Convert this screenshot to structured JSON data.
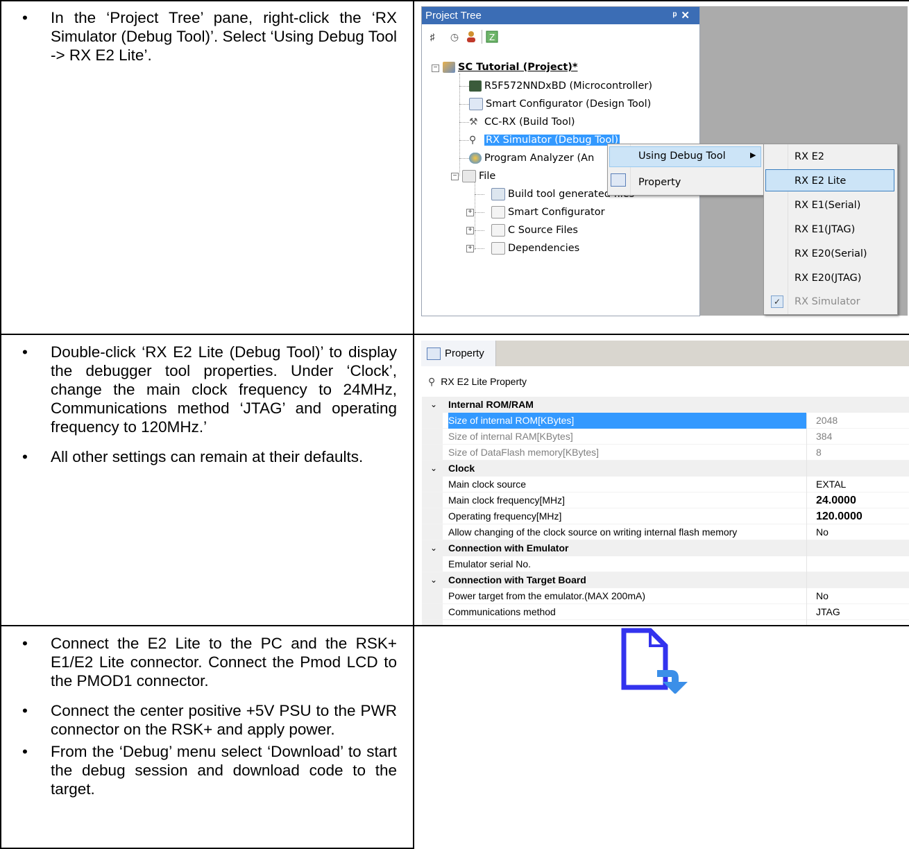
{
  "rows": [
    {
      "bullets": [
        "In the ‘Project Tree’ pane, right-click the ‘RX Simulator (Debug Tool)’.    Select ‘Using Debug Tool -> RX E2 Lite’."
      ]
    },
    {
      "bullets": [
        "Double-click ‘RX E2 Lite (Debug Tool)’ to display the debugger tool properties. Under ‘Clock’, change the main clock frequency to 24MHz, Communications method ‘JTAG’ and operating frequency to 120MHz.’",
        "All other settings can remain at their defaults."
      ]
    },
    {
      "bullets": [
        "Connect the E2 Lite to the PC and the RSK+ E1/E2 Lite connector.  Connect the Pmod LCD to the PMOD1 connector.",
        "Connect the center positive +5V PSU to the PWR connector on the RSK+ and apply power.",
        "From the ‘Debug’ menu select ‘Download’ to start the debug session and download code to the target."
      ]
    }
  ],
  "bullet_char": "•",
  "project_tree": {
    "title": "Project Tree",
    "pin": "ᵖ",
    "close": "✕",
    "project": "SC Tutorial (Project)*",
    "items": [
      "R5F572NNDxBD (Microcontroller)",
      "Smart Configurator (Design Tool)",
      "CC-RX (Build Tool)",
      "RX Simulator (Debug Tool)",
      "Program Analyzer (An",
      "File",
      "Build tool generated files",
      "Smart Configurator",
      "C Source Files",
      "Dependencies"
    ]
  },
  "context_menu": {
    "items": [
      "Using Debug Tool",
      "Property"
    ],
    "submenu": [
      "RX E2",
      "RX E2 Lite",
      "RX E1(Serial)",
      "RX E1(JTAG)",
      "RX E20(Serial)",
      "RX E20(JTAG)",
      "RX Simulator"
    ],
    "selected": "RX E2 Lite",
    "checked": "RX Simulator"
  },
  "property": {
    "tab": "Property",
    "header": "RX E2 Lite Property",
    "rows": [
      {
        "type": "cat",
        "name": "Internal ROM/RAM"
      },
      {
        "type": "sel",
        "name": "Size of internal ROM[KBytes]",
        "value": "2048"
      },
      {
        "type": "dim",
        "name": "Size of internal RAM[KBytes]",
        "value": "384"
      },
      {
        "type": "dim",
        "name": "Size of DataFlash memory[KBytes]",
        "value": "8"
      },
      {
        "type": "cat",
        "name": "Clock"
      },
      {
        "type": "row",
        "name": "Main clock source",
        "value": "EXTAL"
      },
      {
        "type": "bold",
        "name": "Main clock frequency[MHz]",
        "value": "24.0000"
      },
      {
        "type": "bold",
        "name": "Operating frequency[MHz]",
        "value": "120.0000"
      },
      {
        "type": "row",
        "name": "Allow changing of the clock source on writing internal flash memory",
        "value": "No"
      },
      {
        "type": "cat",
        "name": "Connection with Emulator"
      },
      {
        "type": "row",
        "name": "Emulator serial No.",
        "value": ""
      },
      {
        "type": "cat",
        "name": "Connection with Target Board"
      },
      {
        "type": "row",
        "name": "Power target from the emulator.(MAX 200mA)",
        "value": "No"
      },
      {
        "type": "row",
        "name": "Communications method",
        "value": "JTAG"
      }
    ]
  },
  "colors": {
    "title_bar": "#3b6db5",
    "selection": "#3399ff",
    "menu_highlight": "#cce4f7",
    "file_icon": "#3333ee",
    "arrow": "#3b8fe8"
  }
}
